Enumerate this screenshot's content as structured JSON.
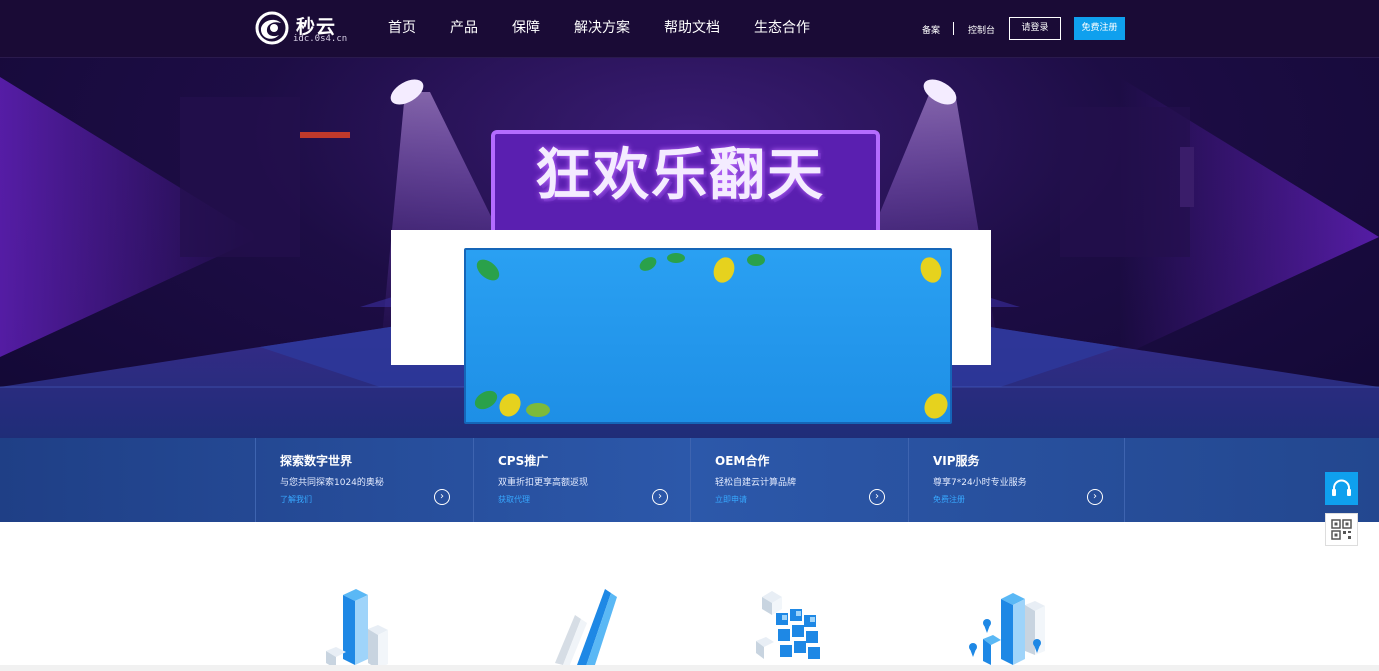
{
  "brand": {
    "name": "秒云",
    "domain": "idc.0s4.cn"
  },
  "nav": {
    "items": [
      "首页",
      "产品",
      "保障",
      "解决方案",
      "帮助文档",
      "生态合作"
    ]
  },
  "header_links": {
    "beian": "备案",
    "console": "控制台",
    "login": "请登录",
    "register": "免费注册"
  },
  "banner": {
    "headline": "狂欢乐翻天"
  },
  "features": [
    {
      "title": "探索数字世界",
      "desc": "与您共同探索1024的奥秘",
      "link": "了解我们"
    },
    {
      "title": "CPS推广",
      "desc": "双重折扣更享高额返现",
      "link": "获取代理"
    },
    {
      "title": "OEM合作",
      "desc": "轻松自建云计算品牌",
      "link": "立即申请"
    },
    {
      "title": "VIP服务",
      "desc": "尊享7*24小时专业服务",
      "link": "免费注册"
    }
  ],
  "colors": {
    "nav_bg": "#1a0b36",
    "accent_blue": "#0fa0ee",
    "strip_bg": "#2c58aa",
    "popup_blue": "#1e8fe6"
  },
  "icons": {
    "support": "headset-icon",
    "qr": "qr-code-icon",
    "arrow": "chevron-right-circle-icon"
  }
}
